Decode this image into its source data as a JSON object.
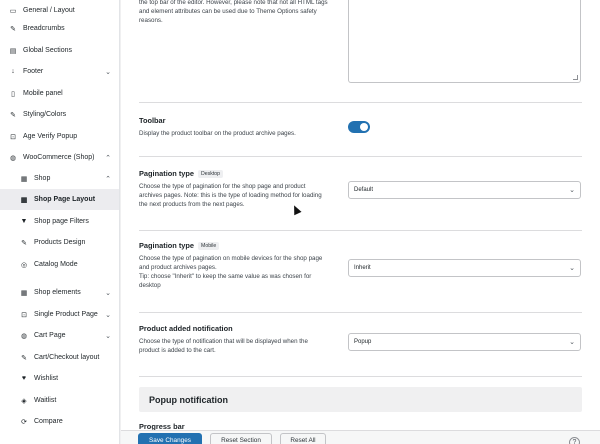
{
  "sidebar": {
    "items": [
      {
        "label": "General / Layout",
        "icon": "layout-icon",
        "glyph": "▭",
        "sub": false,
        "chev": "",
        "active": false
      },
      {
        "label": "Breadcrumbs",
        "icon": "breadcrumbs-icon",
        "glyph": "✎",
        "sub": false,
        "chev": "",
        "active": false
      },
      {
        "label": "Global Sections",
        "icon": "sections-icon",
        "glyph": "▤",
        "sub": false,
        "chev": "",
        "active": false
      },
      {
        "label": "Footer",
        "icon": "footer-icon",
        "glyph": "↓",
        "sub": false,
        "chev": "⌄",
        "active": false
      },
      {
        "label": "Mobile panel",
        "icon": "mobile-icon",
        "glyph": "▯",
        "sub": false,
        "chev": "",
        "active": false
      },
      {
        "label": "Styling/Colors",
        "icon": "brush-icon",
        "glyph": "✎",
        "sub": false,
        "chev": "",
        "active": false
      },
      {
        "label": "Age Verify Popup",
        "icon": "lock-icon",
        "glyph": "⊡",
        "sub": false,
        "chev": "",
        "active": false
      },
      {
        "label": "WooCommerce (Shop)",
        "icon": "cart-icon",
        "glyph": "◍",
        "sub": false,
        "chev": "⌃",
        "active": false
      },
      {
        "label": "Shop",
        "icon": "shop-icon",
        "glyph": "▦",
        "sub": true,
        "chev": "⌃",
        "active": false
      },
      {
        "label": "Shop Page Layout",
        "icon": "grid-icon",
        "glyph": "▦",
        "sub": true,
        "chev": "",
        "active": true
      },
      {
        "label": "Shop page Filters",
        "icon": "filter-icon",
        "glyph": "▼",
        "sub": true,
        "chev": "",
        "active": false
      },
      {
        "label": "Products Design",
        "icon": "design-icon",
        "glyph": "✎",
        "sub": true,
        "chev": "",
        "active": false
      },
      {
        "label": "Catalog Mode",
        "icon": "catalog-icon",
        "glyph": "◎",
        "sub": true,
        "chev": "",
        "active": false
      },
      {
        "label": "Shop elements",
        "icon": "elements-icon",
        "glyph": "▦",
        "sub": true,
        "chev": "⌄",
        "active": false
      },
      {
        "label": "Single Product Page",
        "icon": "product-icon",
        "glyph": "⊡",
        "sub": true,
        "chev": "⌄",
        "active": false
      },
      {
        "label": "Cart Page",
        "icon": "cart-page-icon",
        "glyph": "◍",
        "sub": true,
        "chev": "⌄",
        "active": false
      },
      {
        "label": "Cart/Checkout layout",
        "icon": "checkout-icon",
        "glyph": "✎",
        "sub": true,
        "chev": "",
        "active": false
      },
      {
        "label": "Wishlist",
        "icon": "heart-icon",
        "glyph": "♥",
        "sub": true,
        "chev": "",
        "active": false
      },
      {
        "label": "Waitlist",
        "icon": "bell-icon",
        "glyph": "◈",
        "sub": true,
        "chev": "",
        "active": false
      },
      {
        "label": "Compare",
        "icon": "compare-icon",
        "glyph": "⟳",
        "sub": true,
        "chev": "",
        "active": false
      }
    ]
  },
  "top_desc": "the top bar of the editor. However, please note that not all HTML tags and element attributes can be used due to Theme Options safety reasons.",
  "toolbar": {
    "title": "Toolbar",
    "desc": "Display the product toolbar on the product archive pages."
  },
  "pagination_desktop": {
    "title": "Pagination type",
    "badge": "Desktop",
    "desc": "Choose the type of pagination for the shop page and product archives pages. Note: this is the type of loading method for loading the next products from the next pages.",
    "value": "Default"
  },
  "pagination_mobile": {
    "title": "Pagination type",
    "badge": "Mobile",
    "desc": "Choose the type of pagination on mobile devices for the shop page and product archives pages.",
    "tip": "Tip: choose \"Inherit\" to keep the same value as was chosen for desktop",
    "value": "Inherit"
  },
  "added_notification": {
    "title": "Product added notification",
    "desc": "Choose the type of notification that will be displayed when the product is added to the cart.",
    "value": "Popup"
  },
  "popup_section": {
    "title": "Popup notification"
  },
  "progress_bar": {
    "title": "Progress bar"
  },
  "footer": {
    "save": "Save Changes",
    "reset_section": "Reset Section",
    "reset_all": "Reset All",
    "help": "?"
  },
  "colors": {
    "accent": "#2271b1"
  }
}
